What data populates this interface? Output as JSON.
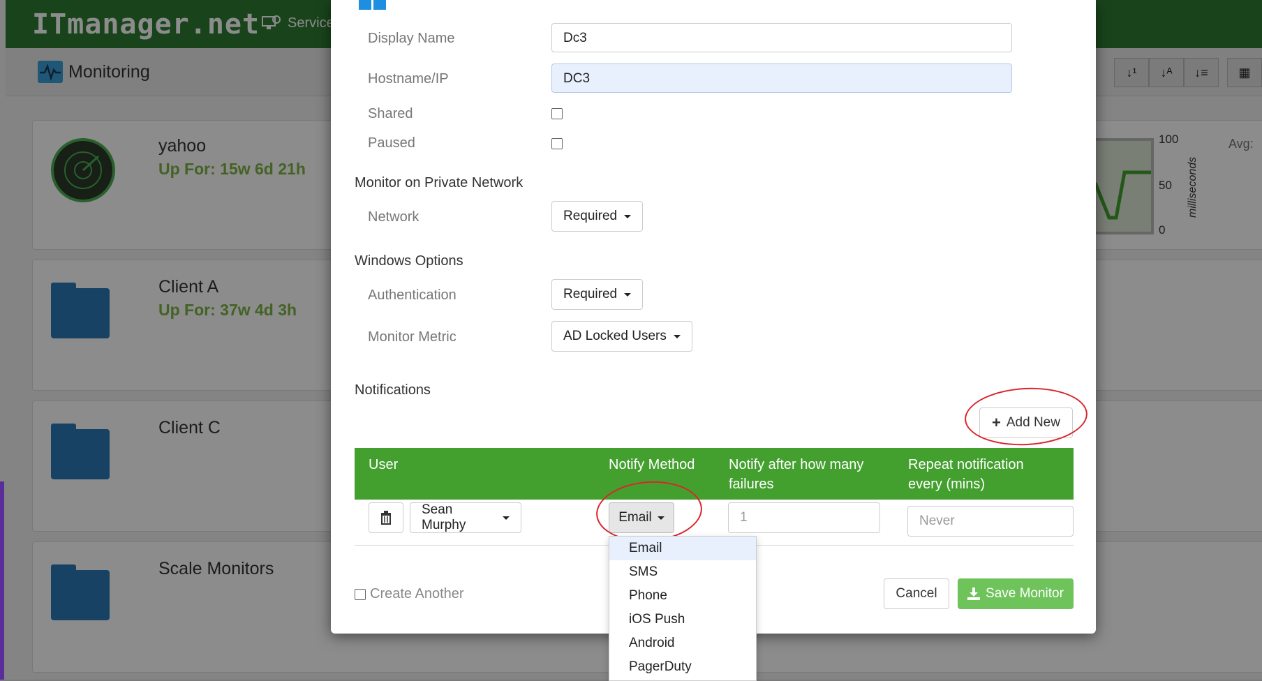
{
  "app": {
    "brand": "ITmanager.net",
    "services_label": "Service",
    "page_title": "Monitoring",
    "sort_icons": [
      "sort-numeric-icon",
      "sort-alpha-icon",
      "sort-list-icon",
      "grid-icon"
    ]
  },
  "background_cards": [
    {
      "name": "yahoo",
      "uptime": "Up For: 15w 6d 21h",
      "icon": "radar-icon"
    },
    {
      "name": "Client A",
      "uptime": "Up For: 37w 4d 3h",
      "icon": "folder-icon"
    },
    {
      "name": "Client C",
      "uptime": "",
      "icon": "folder-icon"
    },
    {
      "name": "Scale Monitors",
      "uptime": "",
      "icon": "folder-icon"
    }
  ],
  "background_chart": {
    "ticks": [
      "100",
      "50",
      "0"
    ],
    "ylabel": "milliseconds",
    "avg_label": "Avg:"
  },
  "modal": {
    "fields": {
      "display_name_label": "Display Name",
      "display_name_value": "Dc3",
      "hostname_label": "Hostname/IP",
      "hostname_value": "DC3",
      "shared_label": "Shared",
      "paused_label": "Paused"
    },
    "private_network": {
      "section": "Monitor on Private Network",
      "network_label": "Network",
      "network_value": "Required"
    },
    "windows": {
      "section": "Windows Options",
      "auth_label": "Authentication",
      "auth_value": "Required",
      "metric_label": "Monitor Metric",
      "metric_value": "AD Locked Users"
    },
    "notifications": {
      "section": "Notifications",
      "add_new_label": "Add New",
      "headers": [
        "User",
        "Notify Method",
        "Notify after how many failures",
        "Repeat notification every (mins)"
      ],
      "row": {
        "user": "Sean Murphy",
        "method": "Email",
        "failures_placeholder": "1",
        "repeat_placeholder": "Never"
      },
      "method_options": [
        "Email",
        "SMS",
        "Phone",
        "iOS Push",
        "Android",
        "PagerDuty"
      ]
    },
    "footer": {
      "create_another": "Create Another",
      "cancel": "Cancel",
      "save": "Save Monitor"
    }
  },
  "colors": {
    "topbar": "#2e7d32",
    "table_header": "#43a02f",
    "save_button": "#6ec35a",
    "annotation": "#d9262b",
    "uptime_text": "#7cb342"
  }
}
